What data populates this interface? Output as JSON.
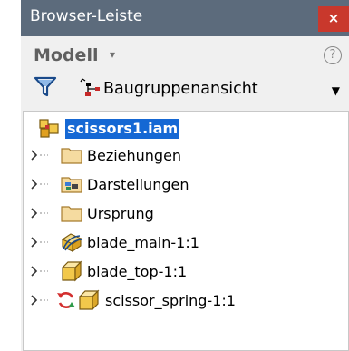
{
  "title_bar": {
    "title": "Browser-Leiste",
    "close_symbol": "×"
  },
  "toolbar": {
    "mode_label": "Modell",
    "mode_caret": "▾",
    "help_symbol": "?",
    "filter_icon": "funnel-icon",
    "view_label": "Baugruppenansicht",
    "view_caret": "▼"
  },
  "tree": {
    "root": {
      "label": "scissors1.iam",
      "icon": "assembly-icon"
    },
    "nodes": [
      {
        "label": "Beziehungen",
        "icon": "folder-icon"
      },
      {
        "label": "Darstellungen",
        "icon": "representations-folder-icon"
      },
      {
        "label": "Ursprung",
        "icon": "folder-icon"
      },
      {
        "label": "blade_main-1:1",
        "icon": "flexible-part-icon"
      },
      {
        "label": "blade_top-1:1",
        "icon": "part-icon"
      },
      {
        "label": "scissor_spring-1:1",
        "icon": "part-icon",
        "status_icon": "relationship-icon"
      }
    ]
  },
  "colors": {
    "title_bar": "#5c6b7c",
    "close_button": "#c9382c",
    "selection": "#1568d4",
    "folder": "#f5dba0",
    "part": "#f2c84b"
  }
}
